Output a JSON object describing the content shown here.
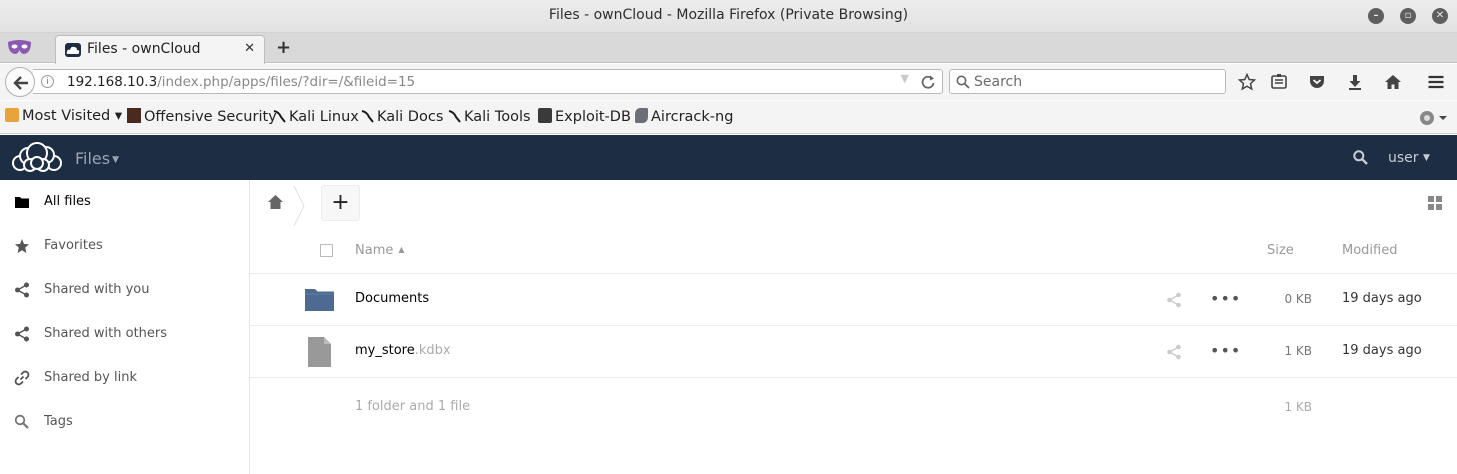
{
  "window": {
    "title": "Files - ownCloud - Mozilla Firefox (Private Browsing)"
  },
  "browser": {
    "tab": {
      "title": "Files - ownCloud",
      "close": "✕"
    },
    "new_tab": "+",
    "url": {
      "host": "192.168.10.3",
      "path": "/index.php/apps/files/?dir=/&fileid=15"
    },
    "search_placeholder": "Search",
    "bookmarks": [
      {
        "label": "Most Visited ▾",
        "icon": "most-visited-icon"
      },
      {
        "label": "Offensive Security",
        "icon": "offsec-icon"
      },
      {
        "label": "Kali Linux",
        "icon": "kali-icon"
      },
      {
        "label": "Kali Docs",
        "icon": "kali-icon"
      },
      {
        "label": "Kali Tools",
        "icon": "kali-icon"
      },
      {
        "label": "Exploit-DB",
        "icon": "exploitdb-icon"
      },
      {
        "label": "Aircrack-ng",
        "icon": "aircrack-icon"
      }
    ]
  },
  "app": {
    "name": "Files",
    "user": "user",
    "colors": {
      "header": "#1d2d44",
      "folder": "#4d6a93",
      "file": "#999999"
    }
  },
  "sidebar": {
    "items": [
      {
        "label": "All files",
        "icon": "folder-icon",
        "active": true
      },
      {
        "label": "Favorites",
        "icon": "star-icon"
      },
      {
        "label": "Shared with you",
        "icon": "share-icon"
      },
      {
        "label": "Shared with others",
        "icon": "share-icon"
      },
      {
        "label": "Shared by link",
        "icon": "link-icon"
      },
      {
        "label": "Tags",
        "icon": "tag-search-icon"
      }
    ]
  },
  "files": {
    "new_button": "+",
    "columns": {
      "name": "Name",
      "sort": "▲",
      "size": "Size",
      "modified": "Modified"
    },
    "rows": [
      {
        "name": "Documents",
        "ext": "",
        "type": "folder",
        "size": "0 KB",
        "modified": "19 days ago",
        "more": "•••"
      },
      {
        "name": "my_store",
        "ext": ".kdbx",
        "type": "file",
        "size": "1 KB",
        "modified": "19 days ago",
        "more": "•••"
      }
    ],
    "summary": {
      "text": "1 folder and 1 file",
      "size": "1 KB"
    }
  }
}
